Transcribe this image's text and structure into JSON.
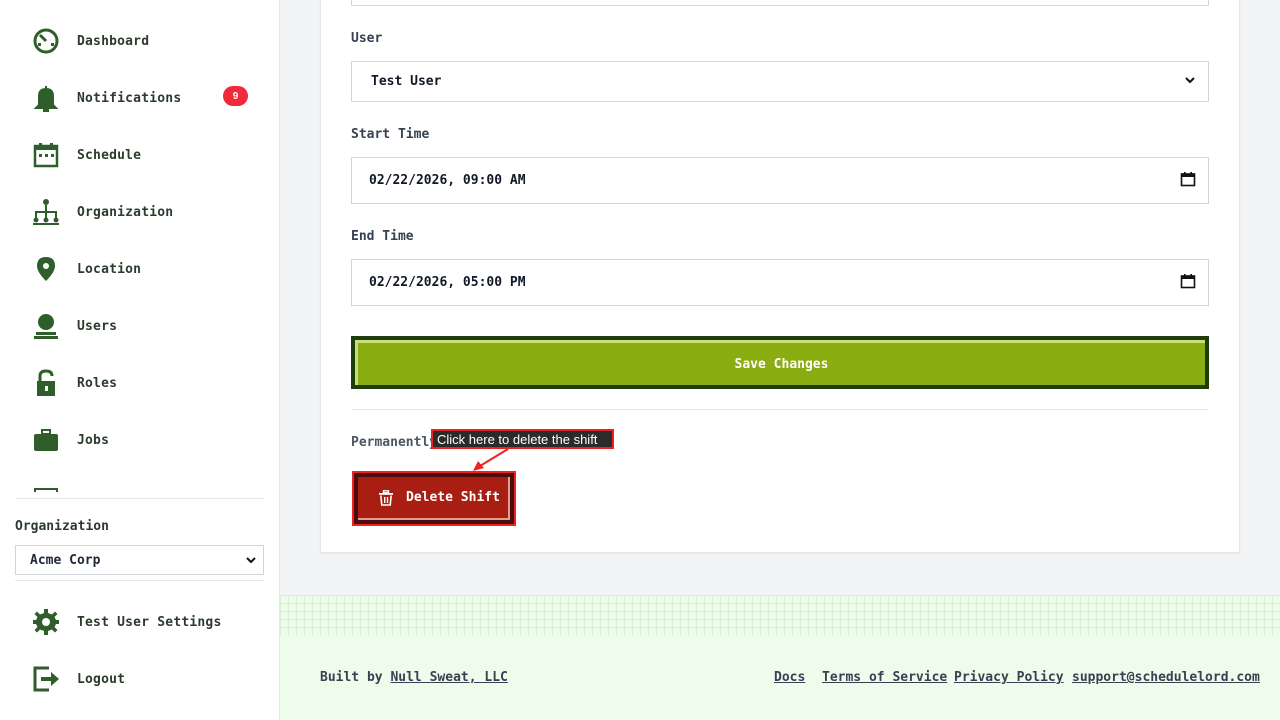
{
  "sidebar": {
    "items": [
      {
        "label": "Dashboard",
        "icon": "dashboard-icon"
      },
      {
        "label": "Notifications",
        "icon": "bell-icon",
        "badge": "9"
      },
      {
        "label": "Schedule",
        "icon": "calendar-icon"
      },
      {
        "label": "Organization",
        "icon": "org-chart-icon"
      },
      {
        "label": "Location",
        "icon": "location-pin-icon"
      },
      {
        "label": "Users",
        "icon": "user-icon"
      },
      {
        "label": "Roles",
        "icon": "lock-icon"
      },
      {
        "label": "Jobs",
        "icon": "briefcase-icon"
      }
    ],
    "org_label": "Organization",
    "org_selected": "Acme Corp",
    "settings_label": "Test User Settings",
    "logout_label": "Logout"
  },
  "form": {
    "user_label": "User",
    "user_value": "Test User",
    "start_label": "Start Time",
    "start_value": "02/22/2026, 09:00 AM",
    "end_label": "End Time",
    "end_value": "02/22/2026, 05:00 PM",
    "save_label": "Save Changes",
    "permanently_text": "Permanently",
    "delete_label": "Delete Shift",
    "tooltip": "Click here to delete the shift"
  },
  "footer": {
    "built_by": "Built by",
    "company": "Null Sweat, LLC",
    "links": [
      "Docs",
      "Terms of Service",
      "Privacy Policy",
      "support@schedulelord.com"
    ]
  },
  "colors": {
    "accent_green": "#8aad12",
    "dark_green": "#1f3d0c",
    "danger": "#a81e13",
    "badge": "#ef2b3a",
    "icon_green": "#2f5e2a"
  }
}
